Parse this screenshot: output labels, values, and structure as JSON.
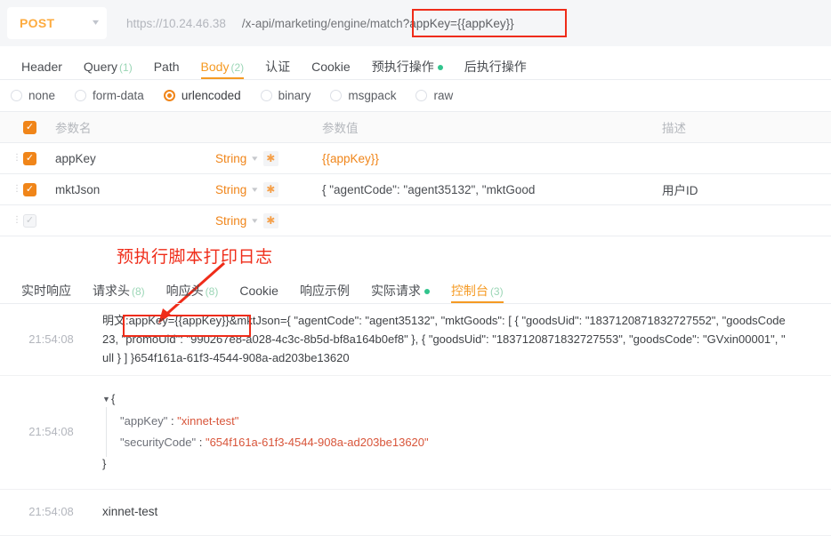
{
  "urlbar": {
    "method": "POST",
    "method_chevron": "chevron-down-icon",
    "host": "https://10.24.46.38",
    "path": "/x-api/marketing/engine/match",
    "query": "?appKey={{appKey}}"
  },
  "request_tabs": [
    {
      "label": "Header",
      "count": "",
      "active": false,
      "dot": false
    },
    {
      "label": "Query",
      "count": "(1)",
      "active": false,
      "dot": false
    },
    {
      "label": "Path",
      "count": "",
      "active": false,
      "dot": false
    },
    {
      "label": "Body",
      "count": "(2)",
      "active": true,
      "dot": false
    },
    {
      "label": "认证",
      "count": "",
      "active": false,
      "dot": false
    },
    {
      "label": "Cookie",
      "count": "",
      "active": false,
      "dot": false
    },
    {
      "label": "预执行操作",
      "count": "",
      "active": false,
      "dot": true
    },
    {
      "label": "后执行操作",
      "count": "",
      "active": false,
      "dot": false
    }
  ],
  "body_types": [
    {
      "label": "none",
      "selected": false
    },
    {
      "label": "form-data",
      "selected": false
    },
    {
      "label": "urlencoded",
      "selected": true
    },
    {
      "label": "binary",
      "selected": false
    },
    {
      "label": "msgpack",
      "selected": false
    },
    {
      "label": "raw",
      "selected": false
    }
  ],
  "param_table": {
    "headers": {
      "name": "参数名",
      "value": "参数值",
      "desc": "描述"
    },
    "header_checked": true,
    "rows": [
      {
        "checked": true,
        "checkbox_state": "checked-orange",
        "name": "appKey",
        "type": "String",
        "required": "★",
        "value": "{{appKey}}",
        "value_is_template": true,
        "desc": ""
      },
      {
        "checked": true,
        "checkbox_state": "checked-orange",
        "name": "mktJson",
        "type": "String",
        "required": "★",
        "value": "{   \"agentCode\": \"agent35132\",   \"mktGood",
        "value_is_template": false,
        "desc": "用户ID"
      },
      {
        "checked": false,
        "checkbox_state": "checked-gray",
        "name": "",
        "type": "String",
        "required": "★",
        "value": "",
        "value_is_template": false,
        "desc": ""
      }
    ]
  },
  "annotation": {
    "text": "预执行脚本打印日志",
    "color": "#ef2c19"
  },
  "response_tabs": [
    {
      "label": "实时响应",
      "count": "",
      "active": false,
      "dot": false
    },
    {
      "label": "请求头",
      "count": "(8)",
      "active": false,
      "dot": false
    },
    {
      "label": "响应头",
      "count": "(8)",
      "active": false,
      "dot": false
    },
    {
      "label": "Cookie",
      "count": "",
      "active": false,
      "dot": false
    },
    {
      "label": "响应示例",
      "count": "",
      "active": false,
      "dot": false
    },
    {
      "label": "实际请求",
      "count": "",
      "active": false,
      "dot": true
    },
    {
      "label": "控制台",
      "count": "(3)",
      "active": true,
      "dot": false
    }
  ],
  "console_log": {
    "entries": [
      {
        "time": "21:54:08",
        "type": "text",
        "lines": [
          "明文:appKey={{appKey}}&mktJson={ \"agentCode\": \"agent35132\", \"mktGoods\": [ { \"goodsUid\": \"1837120871832727552\", \"goodsCode",
          "23, \"promoUid\": \"990267e8-a028-4c3c-8b5d-bf8a164b0ef8\" }, { \"goodsUid\": \"1837120871832727553\", \"goodsCode\": \"GVxin00001\", \"",
          "ull } ] }654f161a-61f3-4544-908a-ad203be13620"
        ]
      },
      {
        "time": "21:54:08",
        "type": "json",
        "open_brace": "{",
        "close_brace": "}",
        "fields": [
          {
            "key": "\"appKey\"",
            "sep": " : ",
            "value": "\"xinnet-test\""
          },
          {
            "key": "\"securityCode\"",
            "sep": " : ",
            "value": "\"654f161a-61f3-4544-908a-ad203be13620\""
          }
        ]
      },
      {
        "time": "21:54:08",
        "type": "text",
        "lines": [
          "xinnet-test"
        ]
      }
    ]
  },
  "colors": {
    "accent": "#f08519",
    "tab_active": "#f59a23",
    "annotation_red": "#ef2c19",
    "count_green": "#9bd6b6",
    "dot_green": "#31c48d",
    "json_string": "#d8553a"
  }
}
